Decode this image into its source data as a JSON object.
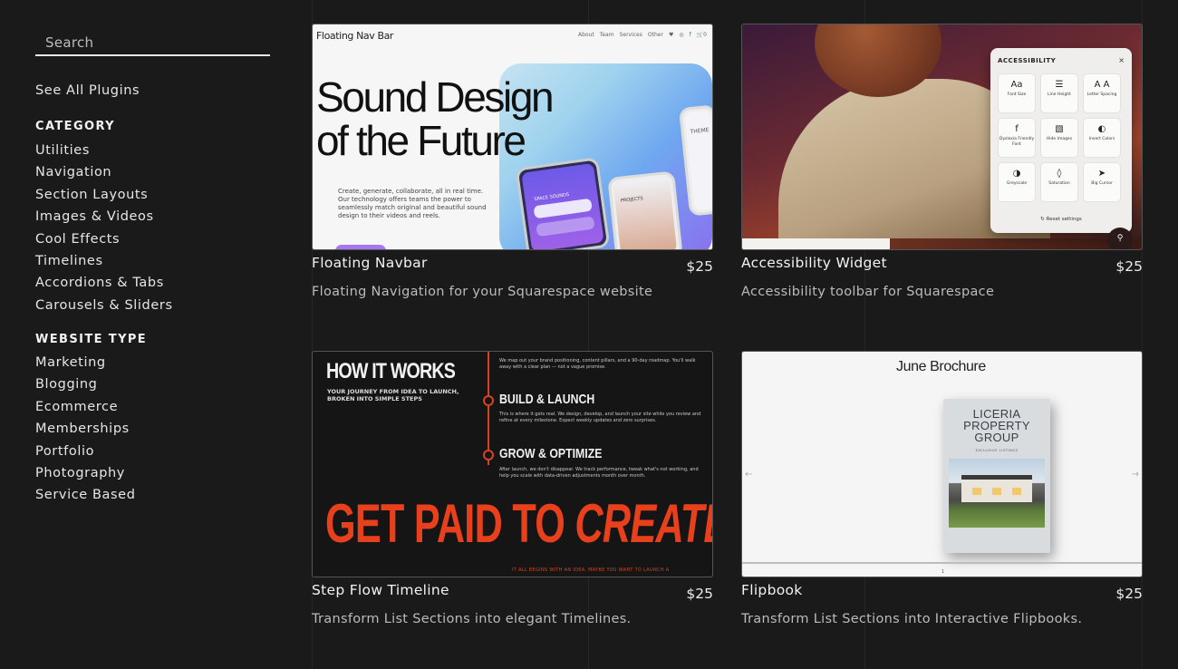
{
  "sidebar": {
    "search_placeholder": "Search",
    "see_all": "See All Plugins",
    "category_title": "CATEGORY",
    "categories": [
      "Utilities",
      "Navigation",
      "Section Layouts",
      "Images & Videos",
      "Cool Effects",
      "Timelines",
      "Accordions & Tabs",
      "Carousels & Sliders"
    ],
    "website_type_title": "WEBSITE TYPE",
    "website_types": [
      "Marketing",
      "Blogging",
      "Ecommerce",
      "Memberships",
      "Portfolio",
      "Photography",
      "Service Based"
    ]
  },
  "products": [
    {
      "title": "Floating Navbar",
      "price": "$25",
      "description": "Floating Navigation for your Squarespace website",
      "thumb": {
        "logo": "Floating Nav Bar",
        "nav": [
          "About",
          "Team",
          "Services",
          "Other",
          "🛒0"
        ],
        "headline": "Sound Design of the Future",
        "body": "Create, generate, collaborate, all in real time. Our technology offers teams the power to seamlessly match original and beautiful sound design to their videos and reels.",
        "phone_labels": [
          "SPACE SOUNDS",
          "PROJECTS",
          "THEME"
        ]
      }
    },
    {
      "title": "Accessibility Widget",
      "price": "$25",
      "description": "Accessibility toolbar for Squarespace",
      "thumb": {
        "panel_title": "ACCESSIBILITY",
        "close": "×",
        "options": [
          {
            "icon": "Aa",
            "label": "Font Size"
          },
          {
            "icon": "☰",
            "label": "Line Height"
          },
          {
            "icon": "A A",
            "label": "Letter Spacing"
          },
          {
            "icon": "f",
            "label": "Dyslexia Friendly Font"
          },
          {
            "icon": "▧",
            "label": "Hide Images"
          },
          {
            "icon": "◐",
            "label": "Invert Colors"
          },
          {
            "icon": "◑",
            "label": "Greyscale"
          },
          {
            "icon": "◊",
            "label": "Saturation"
          },
          {
            "icon": "➤",
            "label": "Big Cursor"
          }
        ],
        "reset": "↻ Reset settings"
      }
    },
    {
      "title": "Step Flow Timeline",
      "price": "$25",
      "description": "Transform List Sections into elegant Timelines.",
      "thumb": {
        "heading": "HOW IT WORKS",
        "subheading": "YOUR JOURNEY FROM IDEA TO LAUNCH, BROKEN INTO SIMPLE STEPS",
        "step0_body": "We map out your brand positioning, content pillars, and a 90-day roadmap. You'll walk away with a clear plan — not a vague promise.",
        "step1_title": "BUILD & LAUNCH",
        "step1_body": "This is where it gets real. We design, develop, and launch your site while you review and refine at every milestone. Expect weekly updates and zero surprises.",
        "step2_title": "GROW & OPTIMIZE",
        "step2_body": "After launch, we don't disappear. We track performance, tweak what's not working, and help you scale with data-driven adjustments month over month.",
        "banner_part1": "GET PAID TO ",
        "banner_part2": "CREATE",
        "footer": "IT ALL BEGINS WITH AN IDEA. MAYBE YOU WANT TO LAUNCH A"
      }
    },
    {
      "title": "Flipbook",
      "price": "$25",
      "description": "Transform List Sections into Interactive Flipbooks.",
      "thumb": {
        "heading": "June Brochure",
        "book_title": "LICERIA PROPERTY GROUP",
        "book_sub": "EXCLUSIVE LISTINGS",
        "page_number": "1"
      }
    }
  ]
}
